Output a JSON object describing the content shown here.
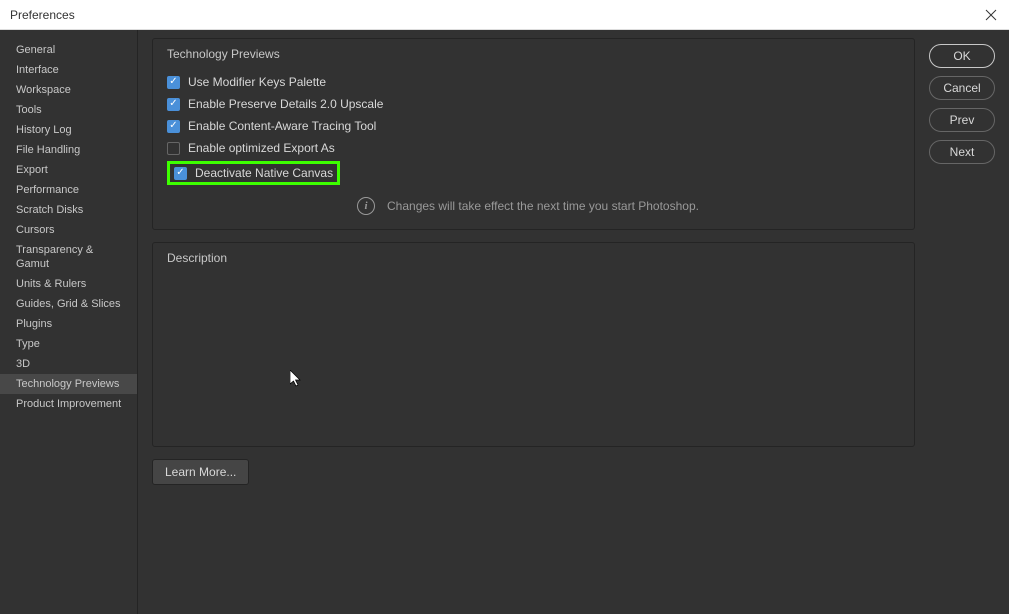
{
  "window": {
    "title": "Preferences"
  },
  "sidebar": {
    "items": [
      {
        "label": "General"
      },
      {
        "label": "Interface"
      },
      {
        "label": "Workspace"
      },
      {
        "label": "Tools"
      },
      {
        "label": "History Log"
      },
      {
        "label": "File Handling"
      },
      {
        "label": "Export"
      },
      {
        "label": "Performance"
      },
      {
        "label": "Scratch Disks"
      },
      {
        "label": "Cursors"
      },
      {
        "label": "Transparency & Gamut"
      },
      {
        "label": "Units & Rulers"
      },
      {
        "label": "Guides, Grid & Slices"
      },
      {
        "label": "Plugins"
      },
      {
        "label": "Type"
      },
      {
        "label": "3D"
      },
      {
        "label": "Technology Previews"
      },
      {
        "label": "Product Improvement"
      }
    ],
    "selected_index": 16
  },
  "section": {
    "title": "Technology Previews",
    "checkboxes": [
      {
        "label": "Use Modifier Keys Palette",
        "checked": true
      },
      {
        "label": "Enable Preserve Details 2.0 Upscale",
        "checked": true
      },
      {
        "label": "Enable Content-Aware Tracing Tool",
        "checked": true
      },
      {
        "label": "Enable optimized Export As",
        "checked": false
      },
      {
        "label": "Deactivate Native Canvas",
        "checked": true
      }
    ],
    "highlighted_index": 4,
    "info_text": "Changes will take effect the next time you start Photoshop."
  },
  "description": {
    "title": "Description"
  },
  "learn_more": {
    "label": "Learn More..."
  },
  "buttons": {
    "ok": "OK",
    "cancel": "Cancel",
    "prev": "Prev",
    "next": "Next"
  }
}
